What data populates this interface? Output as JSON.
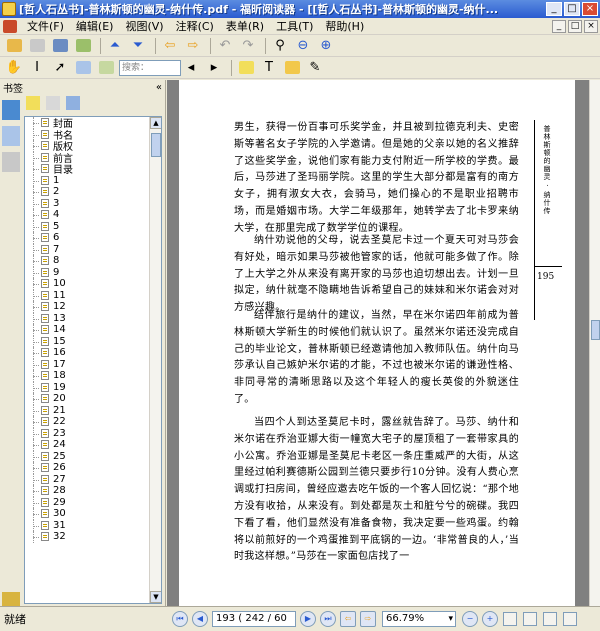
{
  "window": {
    "title": "[哲人石丛书]-普林斯顿的幽灵-纳什传.pdf - 福昕阅读器 - [[哲人石丛书]-普林斯顿的幽灵-纳什...",
    "min_label": "_",
    "max_label": "□",
    "close_label": "×"
  },
  "menu": {
    "items": [
      "文件(F)",
      "编辑(E)",
      "视图(V)",
      "注释(C)",
      "表单(R)",
      "工具(T)",
      "帮助(H)"
    ],
    "mdi": [
      "_",
      "□",
      "×"
    ]
  },
  "toolbar": {
    "zoom_label": "",
    "find_placeholder": "搜索："
  },
  "bookmarks": {
    "header": "书签",
    "collapse": "«",
    "items": [
      "封面",
      "书名",
      "版权",
      "前言",
      "目录",
      "1",
      "2",
      "3",
      "4",
      "5",
      "6",
      "7",
      "8",
      "9",
      "10",
      "11",
      "12",
      "13",
      "14",
      "15",
      "16",
      "17",
      "18",
      "19",
      "20",
      "21",
      "22",
      "23",
      "24",
      "25",
      "26",
      "27",
      "28",
      "29",
      "30",
      "31",
      "32"
    ]
  },
  "document": {
    "running_head": "普林斯顿的幽灵 · 纳什传",
    "page_number": "195",
    "paragraphs": [
      "男生，获得一份百事可乐奖学金，并且被到拉德克利夫、史密斯等著名女子学院的入学邀请。但是她的父亲以她的名义推辞了这些奖学金，说他们家有能力支付附近一所学校的学费。最后，马莎进了圣玛丽学院。这里的学生大部分都是富有的南方女子，拥有淑女大衣，会骑马，她们操心的不是职业招聘市场，而是婚姻市场。大学二年级那年，她转学去了北卡罗来纳大学，在那里完成了数学学位的课程。",
      "纳什劝说他的父母，说去圣莫尼卡过一个夏天可对马莎会有好处，暗示如果马莎被他管家的话，他就可能多做了作。除了上大学之外从来没有离开家的马莎也迫切想出去。计划一旦拟定，纳什就毫不隐瞒地告诉希望自己的妹妹和米尔诺会对对方感兴趣。",
      "结伴旅行是纳什的建议，当然，早在米尔诺四年前成为普林斯顿大学新生的时候他们就认识了。虽然米尔诺还没完成自己的毕业论文，普林斯顿已经邀请他加入教师队伍。纳什向马莎承认自己嫉妒米尔诺的才能，不过也被米尔诺的谦逊性格、非同寻常的清晰思路以及这个年轻人的瘦长英俊的外貌迷住了。",
      "当四个人到达圣莫尼卡时，露丝就告辞了。马莎、纳什和米尔诺在乔治亚娜大街一幢宽大宅子的屋顶租了一套带家具的小公寓。乔治亚娜是圣莫尼卡老区一条庄重威严的大街，从这里经过帕利赛德斯公园到兰德只要步行10分钟。没有人费心烹调或打扫房间，曾经应邀去吃午饭的一个客人回忆说：“那个地方没有收拾，从来没有。到处都是灰土和脏兮兮的碗碟。我四下看了看，他们显然没有准备食物，我决定要一些鸡蛋。约翰将以前煎好的一个鸡蛋推到平底锅的一边。‘非常普良的人，’当时我这样想。”马莎在一家面包店找了一"
    ]
  },
  "status": {
    "text": "就绪",
    "page_input": "193",
    "page_total": "( 242 / 60",
    "zoom": "66.79%"
  }
}
